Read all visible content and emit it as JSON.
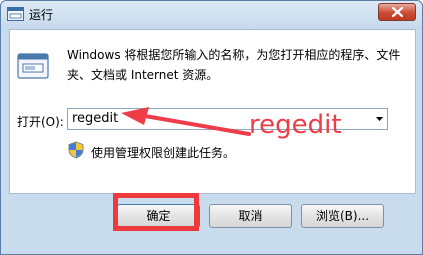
{
  "window": {
    "title": "运行",
    "close_icon": "close-icon",
    "app_icon": "run-app-icon"
  },
  "dialog": {
    "description": "Windows 将根据您所输入的名称，为您打开相应的程序、文件夹、文档或 Internet 资源。",
    "open_label": "打开(O):",
    "command_value": "regedit",
    "admin_note": "使用管理权限创建此任务。",
    "shield_icon": "uac-shield-icon"
  },
  "annotation": {
    "text": "regedit",
    "color": "#ee3d48"
  },
  "buttons": {
    "ok": "确定",
    "cancel": "取消",
    "browse": "浏览(B)..."
  }
}
